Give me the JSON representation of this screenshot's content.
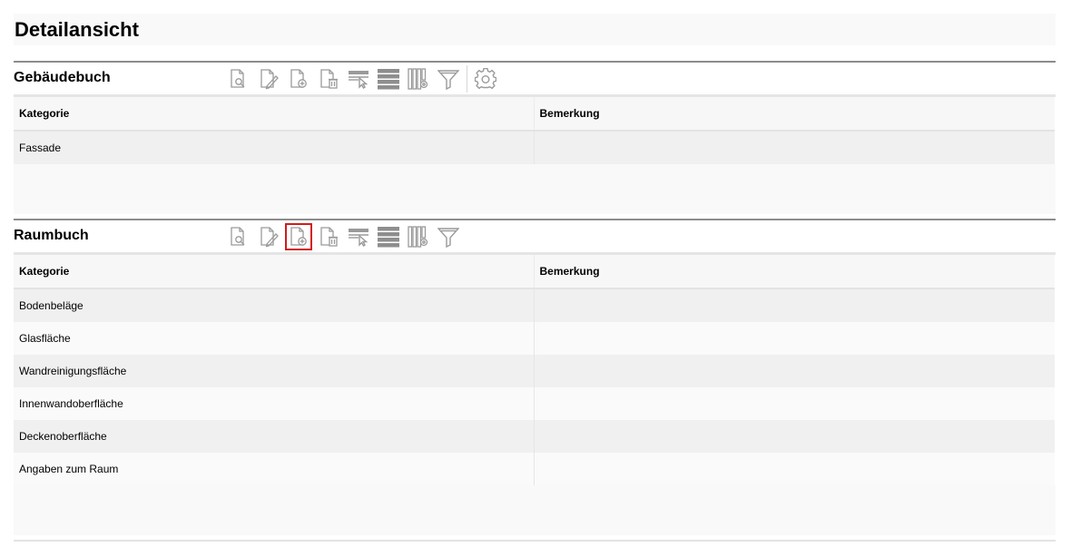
{
  "page": {
    "title": "Detailansicht"
  },
  "gebaeudebuch": {
    "title": "Gebäudebuch",
    "columns": [
      "Kategorie",
      "Bemerkung"
    ],
    "rows": [
      {
        "kategorie": "Fassade",
        "bemerkung": ""
      }
    ]
  },
  "raumbuch": {
    "title": "Raumbuch",
    "columns": [
      "Kategorie",
      "Bemerkung"
    ],
    "rows": [
      {
        "kategorie": "Bodenbeläge",
        "bemerkung": ""
      },
      {
        "kategorie": "Glasfläche",
        "bemerkung": ""
      },
      {
        "kategorie": "Wandreinigungsfläche",
        "bemerkung": ""
      },
      {
        "kategorie": "Innenwandoberfläche",
        "bemerkung": ""
      },
      {
        "kategorie": "Deckenoberfläche",
        "bemerkung": ""
      },
      {
        "kategorie": "Angaben zum Raum",
        "bemerkung": ""
      }
    ]
  },
  "toolbar_icons": {
    "view": "document-search-icon",
    "edit": "document-edit-icon",
    "add": "document-add-icon",
    "delete": "document-delete-icon",
    "select_row": "row-select-icon",
    "rows": "rows-icon",
    "columns": "column-settings-icon",
    "filter": "filter-icon",
    "settings": "gear-icon"
  },
  "colors": {
    "highlight_border": "#d01c1c",
    "icon": "#9a9a9a"
  }
}
